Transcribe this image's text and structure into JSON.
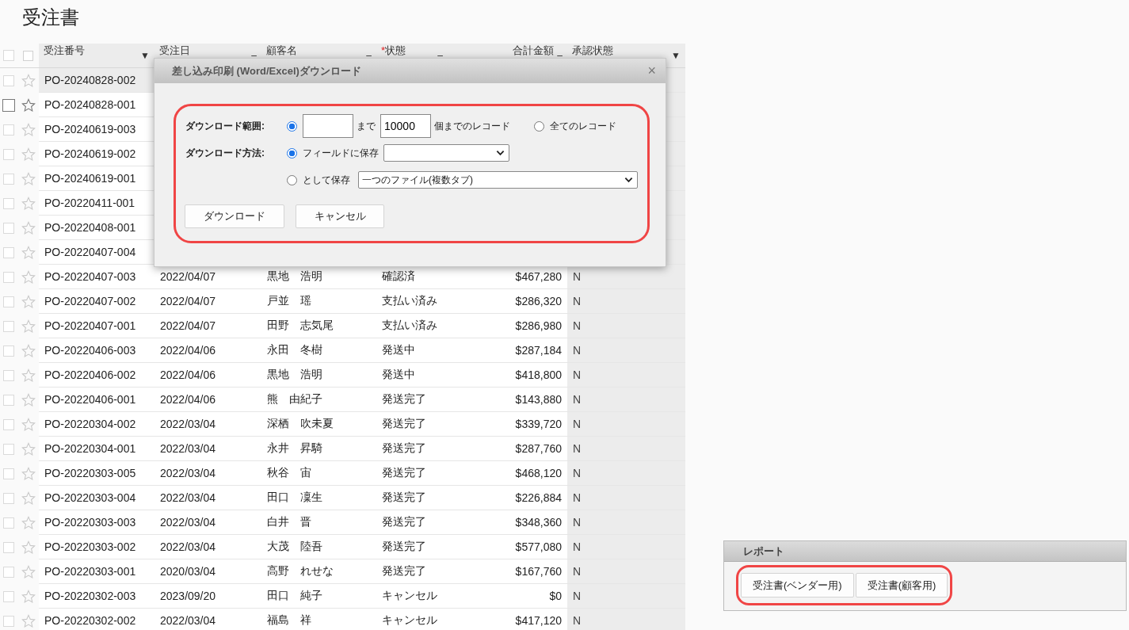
{
  "page_title": "受注書",
  "table": {
    "select_all_checked": false,
    "columns": [
      {
        "label": "受注番号",
        "marker": "▼"
      },
      {
        "label": "受注日",
        "marker": "–"
      },
      {
        "label": "顧客名",
        "marker": "–"
      },
      {
        "label": "状態",
        "required_mark": "*",
        "marker": "–"
      },
      {
        "label": "合計金額",
        "marker": "–"
      },
      {
        "label": "承認状態",
        "marker": "▼"
      }
    ],
    "rows": [
      {
        "id": "PO-20240828-002",
        "checked": false,
        "highlighted": true,
        "hovered": false
      },
      {
        "id": "PO-20240828-001",
        "checked": false,
        "highlighted": false,
        "hovered": true
      },
      {
        "id": "PO-20240619-003",
        "checked": false,
        "highlighted": false,
        "hovered": false
      },
      {
        "id": "PO-20240619-002",
        "checked": false,
        "highlighted": false,
        "hovered": false
      },
      {
        "id": "PO-20240619-001",
        "checked": false,
        "highlighted": false,
        "hovered": false
      },
      {
        "id": "PO-20220411-001",
        "checked": false,
        "highlighted": false,
        "hovered": false
      },
      {
        "id": "PO-20220408-001",
        "checked": false,
        "highlighted": false,
        "hovered": false
      },
      {
        "id": "PO-20220407-004",
        "checked": false,
        "highlighted": false,
        "hovered": false
      },
      {
        "id": "PO-20220407-003",
        "date": "2022/04/07",
        "customer": "黒地　浩明",
        "status": "確認済",
        "total": "$467,280",
        "approval": "N",
        "checked": false,
        "highlighted": false,
        "hovered": false
      },
      {
        "id": "PO-20220407-002",
        "date": "2022/04/07",
        "customer": "戸並　瑶",
        "status": "支払い済み",
        "total": "$286,320",
        "approval": "N",
        "checked": false,
        "highlighted": false,
        "hovered": false
      },
      {
        "id": "PO-20220407-001",
        "date": "2022/04/07",
        "customer": "田野　志気尾",
        "status": "支払い済み",
        "total": "$286,980",
        "approval": "N",
        "checked": false,
        "highlighted": false,
        "hovered": false
      },
      {
        "id": "PO-20220406-003",
        "date": "2022/04/06",
        "customer": "永田　冬樹",
        "status": "発送中",
        "total": "$287,184",
        "approval": "N",
        "checked": false,
        "highlighted": false,
        "hovered": false
      },
      {
        "id": "PO-20220406-002",
        "date": "2022/04/06",
        "customer": "黒地　浩明",
        "status": "発送中",
        "total": "$418,800",
        "approval": "N",
        "checked": false,
        "highlighted": false,
        "hovered": false
      },
      {
        "id": "PO-20220406-001",
        "date": "2022/04/06",
        "customer": "熊　由紀子",
        "status": "発送完了",
        "total": "$143,880",
        "approval": "N",
        "checked": false,
        "highlighted": false,
        "hovered": false
      },
      {
        "id": "PO-20220304-002",
        "date": "2022/03/04",
        "customer": "深栖　吹未夏",
        "status": "発送完了",
        "total": "$339,720",
        "approval": "N",
        "checked": false,
        "highlighted": false,
        "hovered": false
      },
      {
        "id": "PO-20220304-001",
        "date": "2022/03/04",
        "customer": "永井　昇騎",
        "status": "発送完了",
        "total": "$287,760",
        "approval": "N",
        "checked": false,
        "highlighted": false,
        "hovered": false
      },
      {
        "id": "PO-20220303-005",
        "date": "2022/03/04",
        "customer": "秋谷　宙",
        "status": "発送完了",
        "total": "$468,120",
        "approval": "N",
        "checked": false,
        "highlighted": false,
        "hovered": false
      },
      {
        "id": "PO-20220303-004",
        "date": "2022/03/04",
        "customer": "田口　凜生",
        "status": "発送完了",
        "total": "$226,884",
        "approval": "N",
        "checked": false,
        "highlighted": false,
        "hovered": false
      },
      {
        "id": "PO-20220303-003",
        "date": "2022/03/04",
        "customer": "白井　晋",
        "status": "発送完了",
        "total": "$348,360",
        "approval": "N",
        "checked": false,
        "highlighted": false,
        "hovered": false
      },
      {
        "id": "PO-20220303-002",
        "date": "2022/03/04",
        "customer": "大茂　陸吾",
        "status": "発送完了",
        "total": "$577,080",
        "approval": "N",
        "checked": false,
        "highlighted": false,
        "hovered": false
      },
      {
        "id": "PO-20220303-001",
        "date": "2020/03/04",
        "customer": "高野　れせな",
        "status": "発送完了",
        "total": "$167,760",
        "approval": "N",
        "checked": false,
        "highlighted": false,
        "hovered": false
      },
      {
        "id": "PO-20220302-003",
        "date": "2023/09/20",
        "customer": "田口　純子",
        "status": "キャンセル",
        "total": "$0",
        "approval": "N",
        "checked": false,
        "highlighted": false,
        "hovered": false
      },
      {
        "id": "PO-20220302-002",
        "date": "2022/03/04",
        "customer": "福島　祥",
        "status": "キャンセル",
        "total": "$417,120",
        "approval": "N",
        "checked": false,
        "highlighted": false,
        "hovered": false
      }
    ]
  },
  "dialog": {
    "title": "差し込み印刷 (Word/Excel)ダウンロード",
    "close": "×",
    "range": {
      "label": "ダウンロード範囲:",
      "options": [
        {
          "kind": "span",
          "selected": true,
          "between": "まで",
          "to": "10000",
          "suffix": "個までのレコード"
        },
        {
          "kind": "all",
          "selected": false,
          "label": "全てのレコード"
        }
      ]
    },
    "method": {
      "label": "ダウンロード方法:",
      "options": [
        {
          "label": "フィールドに保存",
          "selected": true
        },
        {
          "label": "として保存",
          "selected": false,
          "select_value": "一つのファイル(複数タブ)"
        }
      ]
    },
    "buttons": [
      "ダウンロード",
      "キャンセル"
    ]
  },
  "report": {
    "title": "レポート",
    "buttons": [
      "受注書(ベンダー用)",
      "受注書(顧客用)"
    ]
  }
}
